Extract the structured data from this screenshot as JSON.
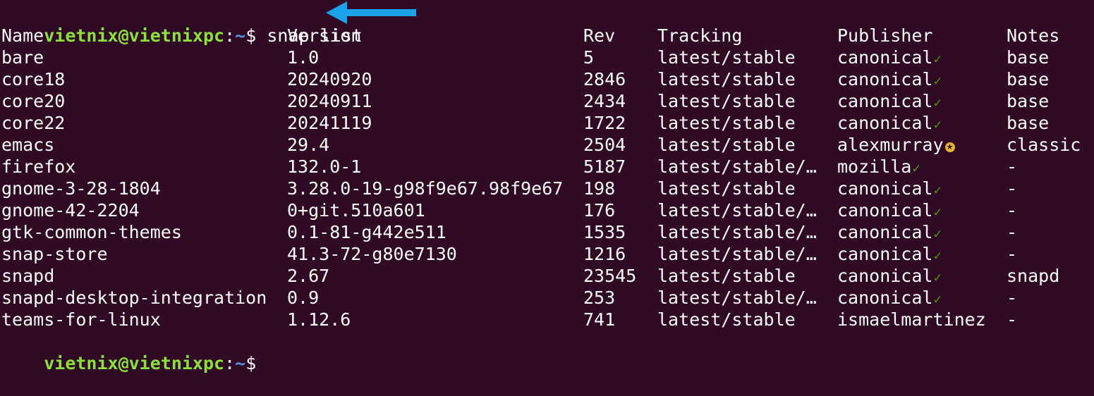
{
  "prompt": {
    "user_host": "vietnix@vietnixpc",
    "colon": ":",
    "path": "~",
    "dollar": "$"
  },
  "command": "snap list",
  "colors": {
    "background": "#300a24",
    "prompt_user": "#8ae234",
    "prompt_path": "#5b91d8",
    "arrow": "#1aa3e8",
    "verified": "#4e9a06",
    "star": "#e3b524"
  },
  "table": {
    "headers": [
      "Name",
      "Version",
      "Rev",
      "Tracking",
      "Publisher",
      "Notes"
    ],
    "rows": [
      {
        "name": "bare",
        "version": "1.0",
        "rev": "5",
        "tracking": "latest/stable",
        "publisher": "canonical",
        "badge": "check",
        "notes": "base"
      },
      {
        "name": "core18",
        "version": "20240920",
        "rev": "2846",
        "tracking": "latest/stable",
        "publisher": "canonical",
        "badge": "check",
        "notes": "base"
      },
      {
        "name": "core20",
        "version": "20240911",
        "rev": "2434",
        "tracking": "latest/stable",
        "publisher": "canonical",
        "badge": "check",
        "notes": "base"
      },
      {
        "name": "core22",
        "version": "20241119",
        "rev": "1722",
        "tracking": "latest/stable",
        "publisher": "canonical",
        "badge": "check",
        "notes": "base"
      },
      {
        "name": "emacs",
        "version": "29.4",
        "rev": "2504",
        "tracking": "latest/stable",
        "publisher": "alexmurray",
        "badge": "star",
        "notes": "classic"
      },
      {
        "name": "firefox",
        "version": "132.0-1",
        "rev": "5187",
        "tracking": "latest/stable/…",
        "publisher": "mozilla",
        "badge": "check",
        "notes": "-"
      },
      {
        "name": "gnome-3-28-1804",
        "version": "3.28.0-19-g98f9e67.98f9e67",
        "rev": "198",
        "tracking": "latest/stable",
        "publisher": "canonical",
        "badge": "check",
        "notes": "-"
      },
      {
        "name": "gnome-42-2204",
        "version": "0+git.510a601",
        "rev": "176",
        "tracking": "latest/stable/…",
        "publisher": "canonical",
        "badge": "check",
        "notes": "-"
      },
      {
        "name": "gtk-common-themes",
        "version": "0.1-81-g442e511",
        "rev": "1535",
        "tracking": "latest/stable/…",
        "publisher": "canonical",
        "badge": "check",
        "notes": "-"
      },
      {
        "name": "snap-store",
        "version": "41.3-72-g80e7130",
        "rev": "1216",
        "tracking": "latest/stable/…",
        "publisher": "canonical",
        "badge": "check",
        "notes": "-"
      },
      {
        "name": "snapd",
        "version": "2.67",
        "rev": "23545",
        "tracking": "latest/stable",
        "publisher": "canonical",
        "badge": "check",
        "notes": "snapd"
      },
      {
        "name": "snapd-desktop-integration",
        "version": "0.9",
        "rev": "253",
        "tracking": "latest/stable/…",
        "publisher": "canonical",
        "badge": "check",
        "notes": "-"
      },
      {
        "name": "teams-for-linux",
        "version": "1.12.6",
        "rev": "741",
        "tracking": "latest/stable",
        "publisher": "ismaelmartinez",
        "badge": "none",
        "notes": "-"
      }
    ]
  },
  "icons": {
    "check_glyph": "✓",
    "star_glyph": "✪",
    "arrow": "left-arrow-icon"
  }
}
